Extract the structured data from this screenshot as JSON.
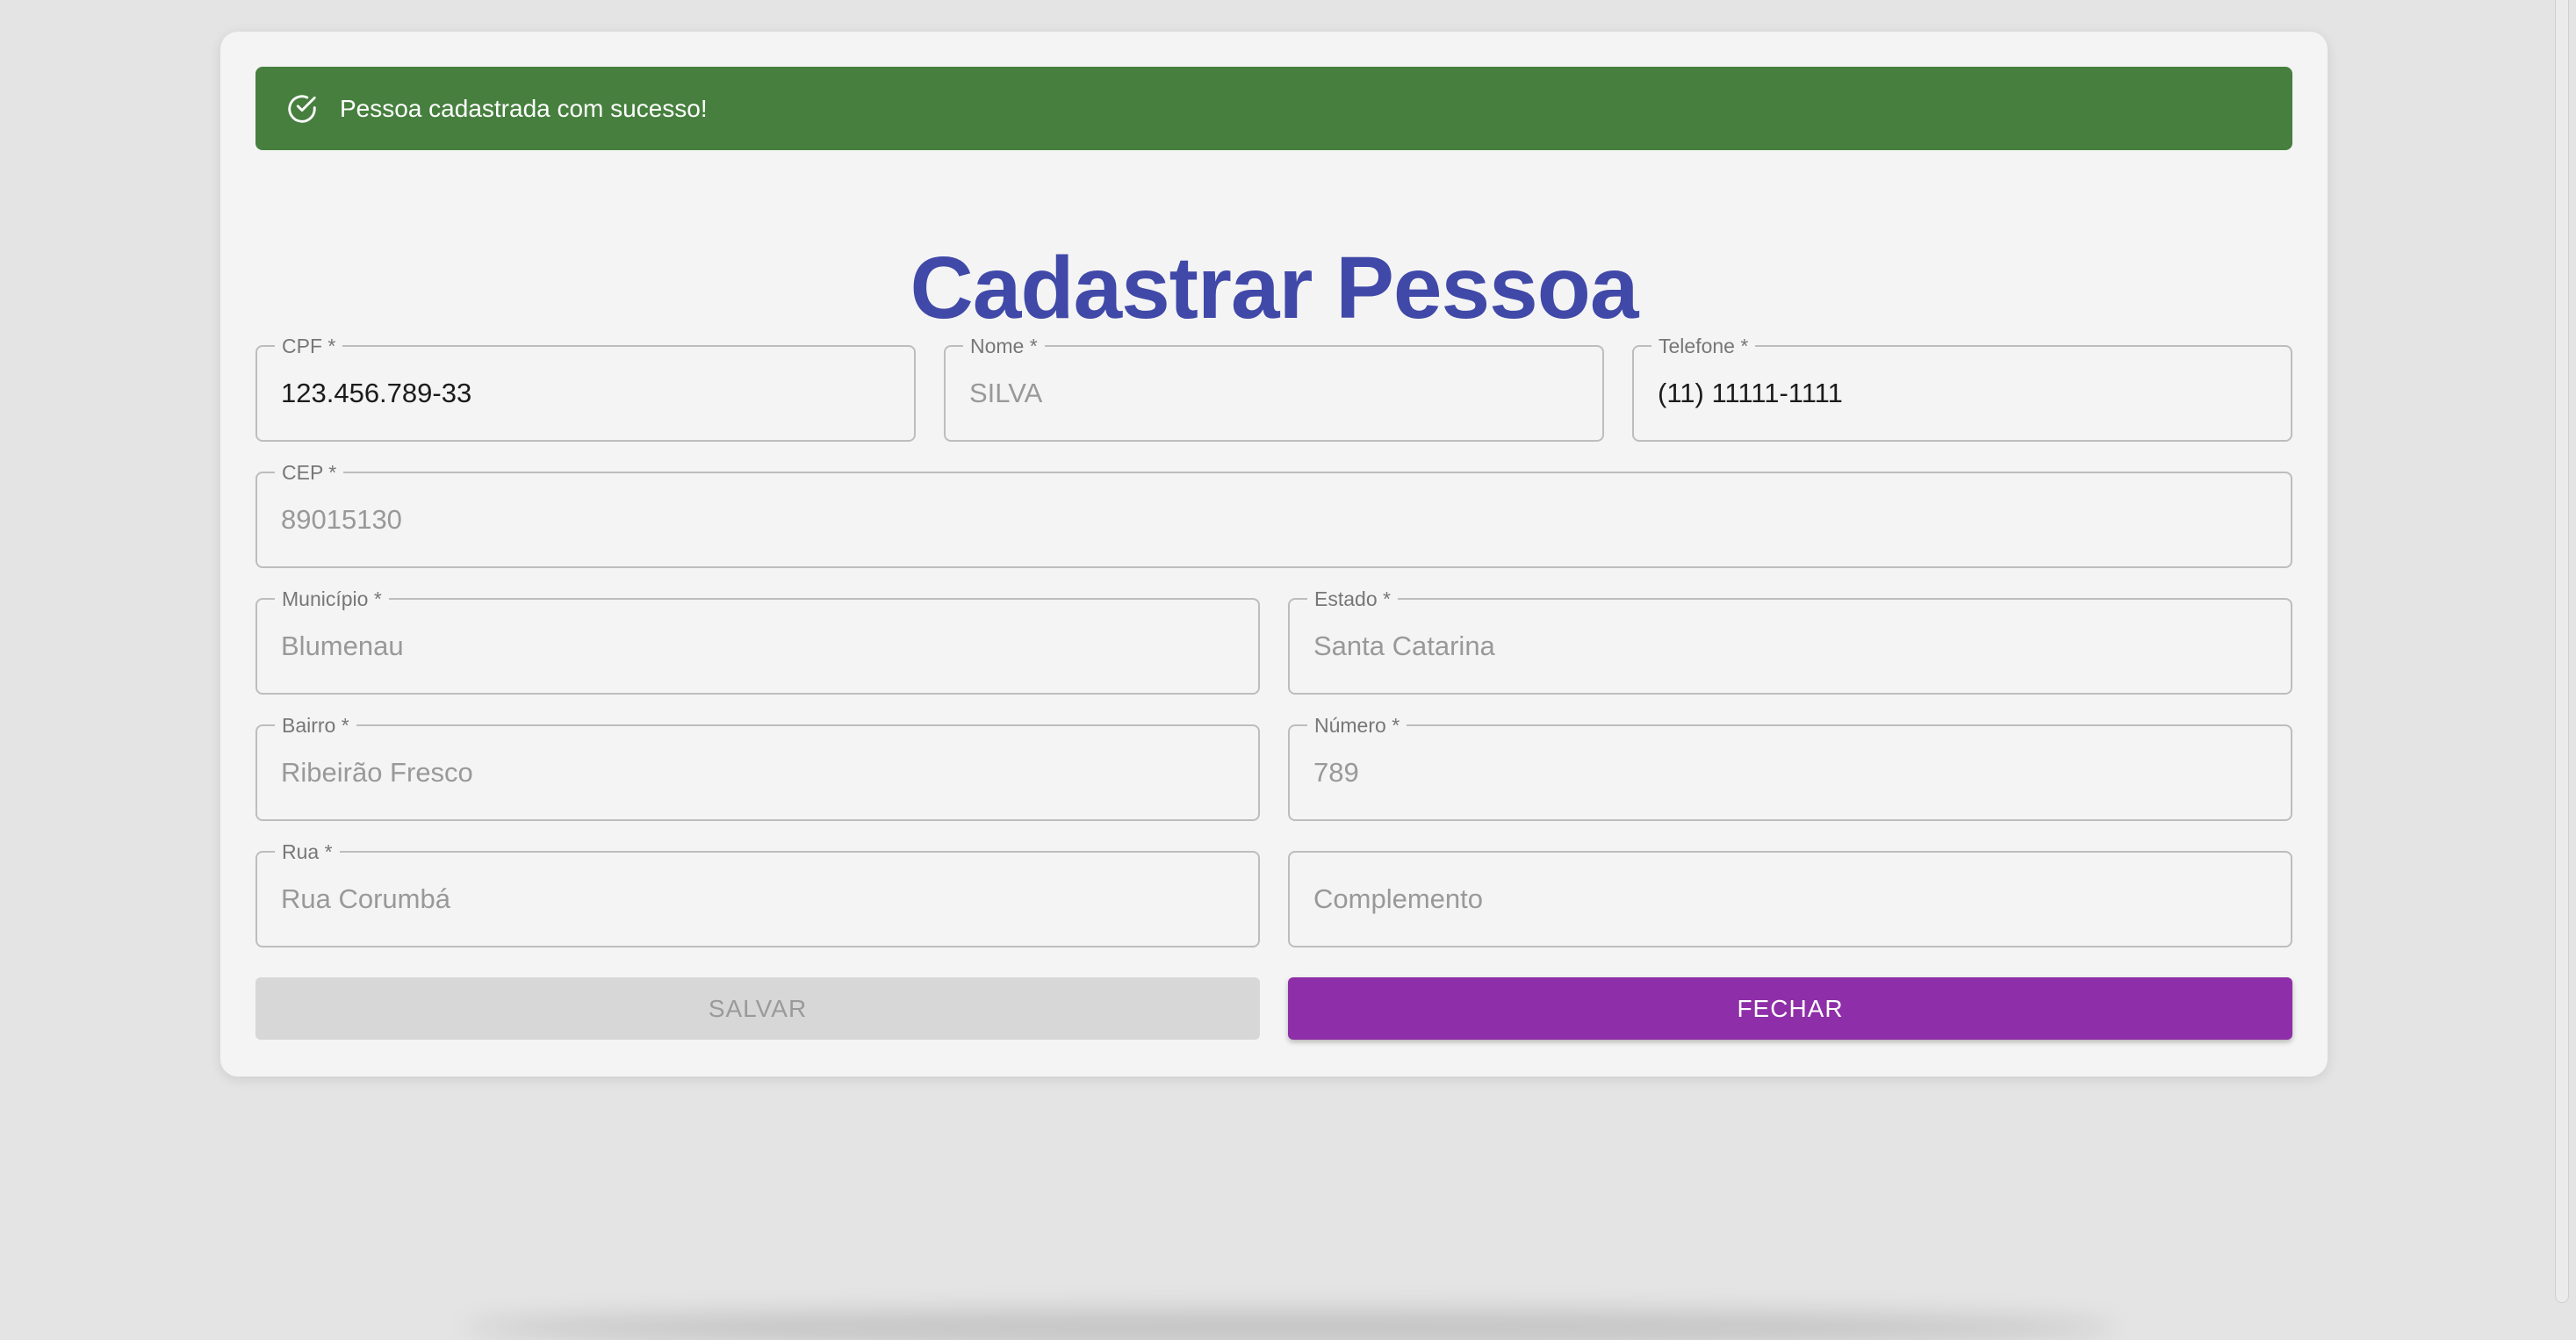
{
  "alert": {
    "message": "Pessoa cadastrada com sucesso!",
    "icon": "check-circle-icon",
    "color": "#467f3e"
  },
  "title": "Cadastrar Pessoa",
  "fields": {
    "cpf": {
      "label": "CPF *",
      "value": "123.456.789-33"
    },
    "nome": {
      "label": "Nome *",
      "value": "SILVA"
    },
    "telefone": {
      "label": "Telefone *",
      "value": "(11) 11111-1111"
    },
    "cep": {
      "label": "CEP *",
      "value": "89015130"
    },
    "municipio": {
      "label": "Município *",
      "value": "Blumenau"
    },
    "estado": {
      "label": "Estado *",
      "value": "Santa Catarina"
    },
    "bairro": {
      "label": "Bairro *",
      "value": "Ribeirão Fresco"
    },
    "numero": {
      "label": "Número *",
      "value": "789"
    },
    "rua": {
      "label": "Rua *",
      "value": "Rua Corumbá"
    },
    "complemento": {
      "placeholder": "Complemento"
    }
  },
  "buttons": {
    "save": "SALVAR",
    "close": "FECHAR"
  },
  "colors": {
    "title": "#4049a8",
    "close_button": "#8e2ea8",
    "save_button_disabled": "#d7d7d7",
    "background": "#e4e4e4",
    "card": "#f4f4f4"
  }
}
